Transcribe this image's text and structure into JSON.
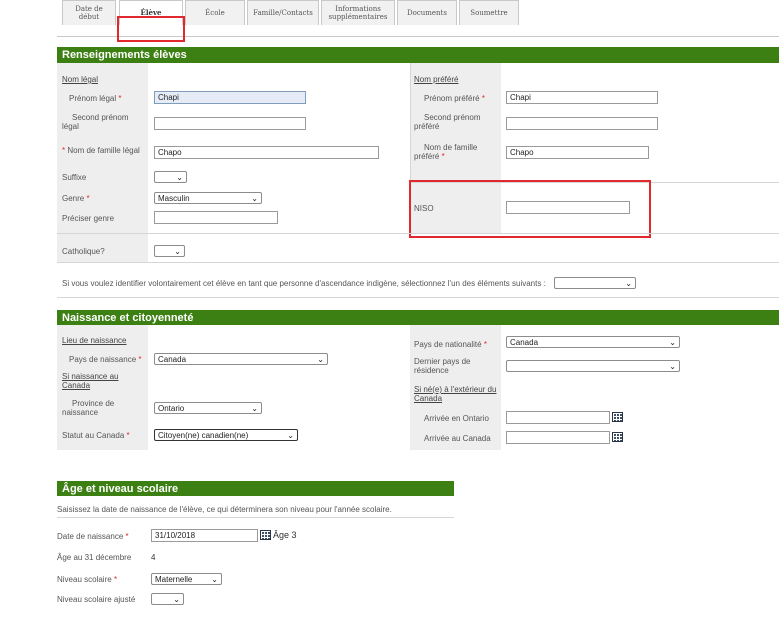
{
  "tabs": [
    {
      "label": "Date de début"
    },
    {
      "label": "Élève"
    },
    {
      "label": "École"
    },
    {
      "label": "Famille/Contacts"
    },
    {
      "label": "Informations supplémentaires"
    },
    {
      "label": "Documents"
    },
    {
      "label": "Soumettre"
    }
  ],
  "renseignements": {
    "title": "Renseignements élèves",
    "nom_legal": "Nom légal",
    "nom_prefere": "Nom préféré",
    "prenom_legal_label": "Prénom légal",
    "prenom_legal_value": "Chapi",
    "second_prenom_legal_label": "Second prénom légal",
    "nom_famille_legal_label": "Nom de famille légal",
    "nom_famille_legal_value": "Chapo",
    "suffixe_label": "Suffixe",
    "genre_label": "Genre",
    "genre_value": "Masculin",
    "preciser_genre_label": "Préciser genre",
    "prenom_prefere_label": "Prénom préféré",
    "prenom_prefere_value": "Chapi",
    "second_prenom_prefere_label": "Second prénom préféré",
    "nom_famille_prefere_label": "Nom de famille préféré",
    "nom_famille_prefere_value": "Chapo",
    "niso_label": "NISO",
    "catholique_label": "Catholique?",
    "autochtone_text": "Si vous voulez identifier volontairement cet élève en tant que personne d'ascendance indigène, sélectionnez l'un des éléments suivants :",
    "required_mark": "*"
  },
  "naissance": {
    "title": "Naissance et citoyenneté",
    "lieu_naissance": "Lieu de naissance",
    "pays_naissance_label": "Pays de naissance",
    "pays_naissance_value": "Canada",
    "si_naissance_canada": "Si naissance au Canada",
    "province_label": "Province de naissance",
    "province_value": "Ontario",
    "statut_label": "Statut au Canada",
    "statut_value": "Citoyen(ne) canadien(ne)",
    "pays_nationalite_label": "Pays de nationalité",
    "pays_nationalite_value": "Canada",
    "dernier_pays_label": "Dernier pays de résidence",
    "si_ne_exterieur": "Si né(e) à l'extérieur du Canada",
    "arrivee_ontario_label": "Arrivée en Ontario",
    "arrivee_canada_label": "Arrivée au Canada"
  },
  "age": {
    "title": "Âge et niveau scolaire",
    "intro": "Saisissez la date de naissance de l'élève, ce qui déterminera son niveau pour l'année scolaire.",
    "date_naissance_label": "Date de naissance",
    "date_naissance_value": "31/10/2018",
    "age_text": "Âge 3",
    "age_31_label": "Âge au 31 décembre",
    "age_31_value": "4",
    "niveau_label": "Niveau scolaire",
    "niveau_value": "Maternelle",
    "niveau_ajuste_label": "Niveau scolaire ajusté"
  },
  "colors": {
    "section_green": "#3c7f12",
    "highlight_red": "#e0282e"
  }
}
